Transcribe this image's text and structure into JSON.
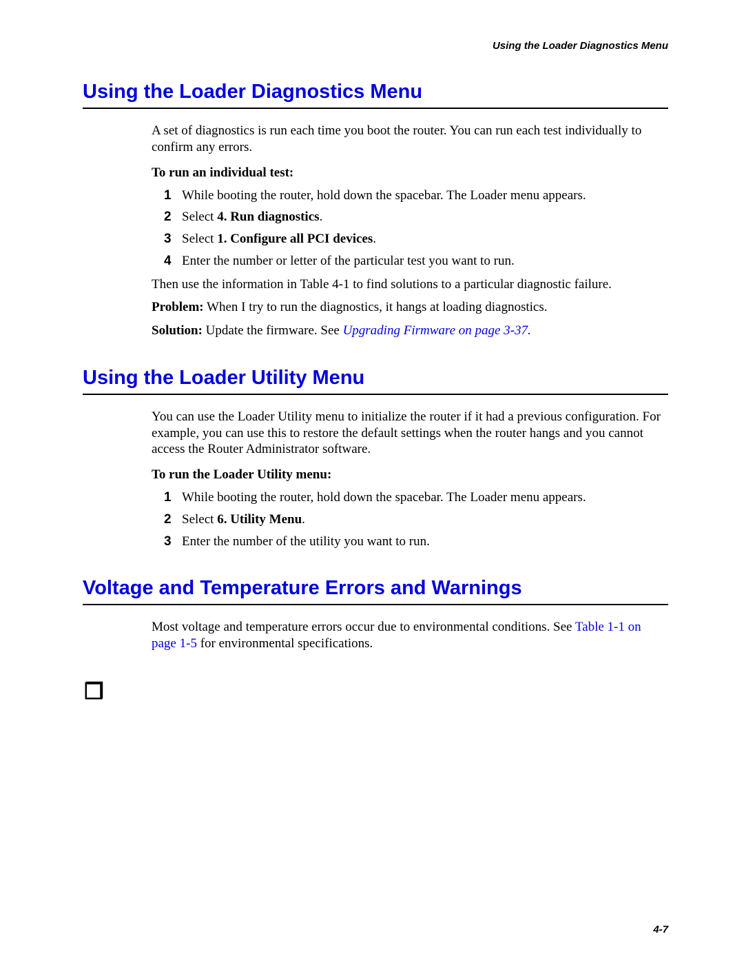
{
  "runningHeader": "Using the Loader Diagnostics Menu",
  "section1": {
    "heading": "Using the Loader Diagnostics Menu",
    "intro": "A set of diagnostics is run each time you boot the router. You can run each test individually to confirm any errors.",
    "subhead": "To run an individual test:",
    "steps": [
      {
        "n": "1",
        "text": "While booting the router, hold down the spacebar. The Loader menu appears."
      },
      {
        "n": "2",
        "prefix": "Select ",
        "bold": "4. Run diagnostics",
        "suffix": "."
      },
      {
        "n": "3",
        "prefix": "Select ",
        "bold": "1. Configure all PCI devices",
        "suffix": "."
      },
      {
        "n": "4",
        "text": "Enter the number or letter of the particular test you want to run."
      }
    ],
    "after": "Then use the information in Table 4-1 to find solutions to a particular diagnostic failure.",
    "problemLabel": "Problem:",
    "problemText": " When I try to run the diagnostics, it hangs at loading diagnostics.",
    "solutionLabel": "Solution:",
    "solutionText": " Update the firmware. See ",
    "solutionLink": "Upgrading Firmware on page 3-37."
  },
  "section2": {
    "heading": "Using the Loader Utility Menu",
    "intro": "You can use the Loader Utility menu to initialize the router if it had a previous configuration. For example, you can use this to restore the default settings when the router hangs and you cannot access the Router Administrator software.",
    "subhead": "To run the Loader Utility menu:",
    "steps": [
      {
        "n": "1",
        "text": "While booting the router, hold down the spacebar. The Loader menu appears."
      },
      {
        "n": "2",
        "prefix": "Select ",
        "bold": "6. Utility Menu",
        "suffix": "."
      },
      {
        "n": "3",
        "text": "Enter the number of the utility you want to run."
      }
    ]
  },
  "section3": {
    "heading": "Voltage and Temperature Errors and Warnings",
    "introPrefix": "Most voltage and temperature errors occur due to environmental conditions. See ",
    "link1": "Table 1-1 on page 1-5",
    "introSuffix": " for environmental specifications."
  },
  "pageNumber": "4-7"
}
